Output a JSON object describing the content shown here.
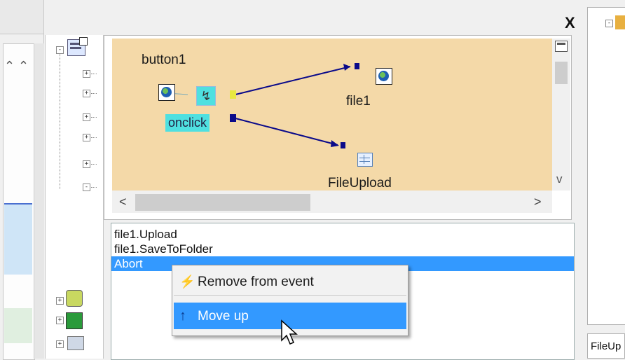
{
  "close_glyph": "X",
  "designer": {
    "source_label": "button1",
    "event_label": "onclick",
    "target1_label": "file1",
    "target2_label": "FileUpload",
    "scroll_left": "<",
    "scroll_right": ">",
    "scroll_down": "v"
  },
  "actions": [
    {
      "label": "file1.Upload"
    },
    {
      "label": "file1.SaveToFolder"
    },
    {
      "label": "Abort"
    }
  ],
  "context_menu": {
    "remove_label": "Remove from event",
    "move_up_label": "Move up"
  },
  "right_panel": {
    "bottom_text": "FileUp"
  },
  "colors": {
    "canvas_bg": "#f4d9a8",
    "selection": "#3399ff",
    "event_highlight": "#4fe0e0",
    "link_arrow": "#0a0a8a"
  }
}
